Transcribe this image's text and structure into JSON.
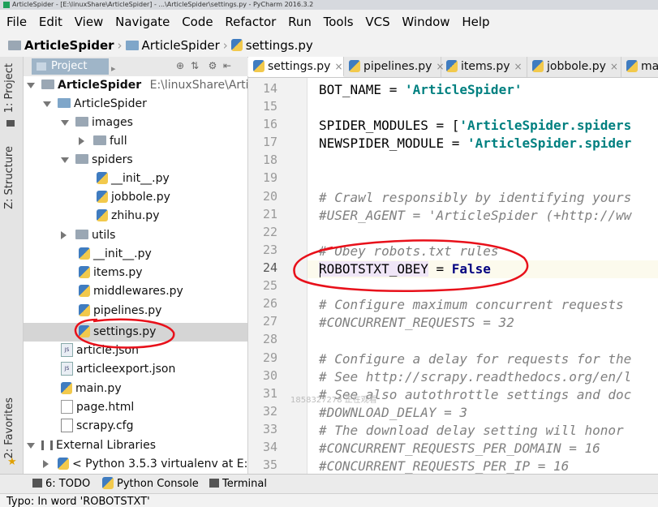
{
  "window": {
    "title": "ArticleSpider - [E:\\linuxShare\\ArticleSpider] - ...\\ArticleSpider\\settings.py - PyCharm 2016.3.2"
  },
  "menu": [
    "File",
    "Edit",
    "View",
    "Navigate",
    "Code",
    "Refactor",
    "Run",
    "Tools",
    "VCS",
    "Window",
    "Help"
  ],
  "breadcrumb": [
    "ArticleSpider",
    "ArticleSpider",
    "settings.py"
  ],
  "project_panel": {
    "tab_label": "Project",
    "root_label": "ArticleSpider",
    "root_path": "E:\\linuxShare\\ArticleSp",
    "tree": [
      "ArticleSpider",
      "images",
      "full",
      "spiders",
      "__init__.py",
      "jobbole.py",
      "zhihu.py",
      "utils",
      "__init__.py",
      "items.py",
      "middlewares.py",
      "pipelines.py",
      "settings.py",
      "article.json",
      "articleexport.json",
      "main.py",
      "page.html",
      "scrapy.cfg",
      "External Libraries",
      "< Python 3.5.3 virtualenv at E:\\Ev"
    ]
  },
  "side_tabs": {
    "project": "1: Project",
    "structure": "Z: Structure",
    "favorites": "2: Favorites"
  },
  "editor_tabs": [
    "settings.py",
    "pipelines.py",
    "items.py",
    "jobbole.py",
    "mai"
  ],
  "line_numbers": [
    "14",
    "15",
    "16",
    "17",
    "18",
    "19",
    "20",
    "21",
    "22",
    "23",
    "24",
    "25",
    "26",
    "27",
    "28",
    "29",
    "30",
    "31",
    "32",
    "33",
    "34",
    "35"
  ],
  "code": {
    "l14_a": "BOT_NAME = ",
    "l14_b": "'ArticleSpider'",
    "l16_a": "SPIDER_MODULES = [",
    "l16_b": "'ArticleSpider.spiders",
    "l17_a": "NEWSPIDER_MODULE = ",
    "l17_b": "'ArticleSpider.spider",
    "l20": "# Crawl responsibly by identifying yours",
    "l21": "#USER_AGENT = 'ArticleSpider (+http://ww",
    "l23": "# Obey robots.txt rules",
    "l24_a": "ROBOTSTXT_OBEY",
    "l24_b": " = ",
    "l24_c": "False",
    "l26": "# Configure maximum concurrent requests",
    "l27": "#CONCURRENT_REQUESTS = 32",
    "l29": "# Configure a delay for requests for the",
    "l30": "# See http://scrapy.readthedocs.org/en/l",
    "l31": "# See also autothrottle settings and doc",
    "l32": "#DOWNLOAD_DELAY = 3",
    "l33": "# The download delay setting will honor",
    "l34": "#CONCURRENT_REQUESTS_PER_DOMAIN = 16",
    "l35": "#CONCURRENT_REQUESTS_PER_IP = 16"
  },
  "watermark": "1858327278 正在观看",
  "bottom_tabs": [
    "6: TODO",
    "Python Console",
    "Terminal"
  ],
  "status": "Typo: In word 'ROBOTSTXT'",
  "colors": {
    "annotation_red": "#e8101a",
    "selection": "#d5d5d5",
    "string": "#008080",
    "keyword": "#000080",
    "comment": "#808080"
  }
}
